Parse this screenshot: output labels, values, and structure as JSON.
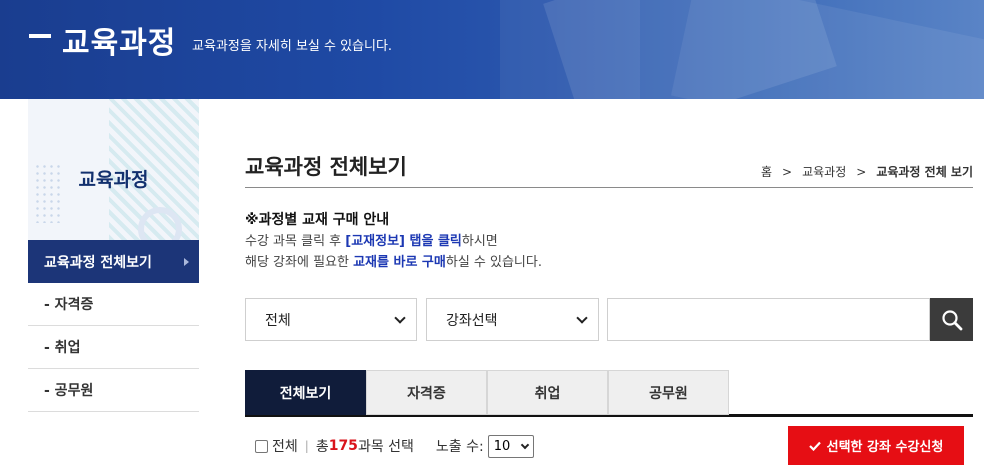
{
  "banner": {
    "title": "교육과정",
    "subtitle": "교육과정을 자세히 보실 수 있습니다."
  },
  "sidebar": {
    "heading": "교육과정",
    "items": [
      {
        "label": "교육과정 전체보기",
        "active": true
      },
      {
        "label": "- 자격증",
        "active": false
      },
      {
        "label": "- 취업",
        "active": false
      },
      {
        "label": "- 공무원",
        "active": false
      }
    ]
  },
  "main": {
    "page_title": "교육과정 전체보기",
    "breadcrumb": [
      "홈",
      "교육과정",
      "교육과정 전체 보기"
    ],
    "breadcrumb_separator": ">",
    "notice": {
      "heading": "※과정별 교재 구매 안내",
      "line1_a": "수강 과목 클릭 후 ",
      "line1_hl": "[교재정보] 탭을 클릭",
      "line1_b": "하시면",
      "line2_a": "해당 강좌에 필요한 ",
      "line2_hl": "교재를 바로 구매",
      "line2_b": "하실 수 있습니다."
    },
    "filters": {
      "category_value": "전체",
      "course_value": "강좌선택",
      "search_value": ""
    },
    "tabs": [
      {
        "label": "전체보기",
        "active": true
      },
      {
        "label": "자격증",
        "active": false
      },
      {
        "label": "취업",
        "active": false
      },
      {
        "label": "공무원",
        "active": false
      }
    ],
    "list_controls": {
      "select_all_label": "전체",
      "total_prefix": "총 ",
      "total_count": "175",
      "total_suffix": "과목 선택",
      "per_page_label": "노출 수:",
      "per_page_value": "10",
      "apply_button": "선택한 강좌 수강신청"
    }
  },
  "colors": {
    "banner_blue": "#1f4aa5",
    "sidebar_active": "#1c3578",
    "tab_active": "#101c3a",
    "highlight_blue": "#1c38b3",
    "accent_red": "#e60e14"
  }
}
